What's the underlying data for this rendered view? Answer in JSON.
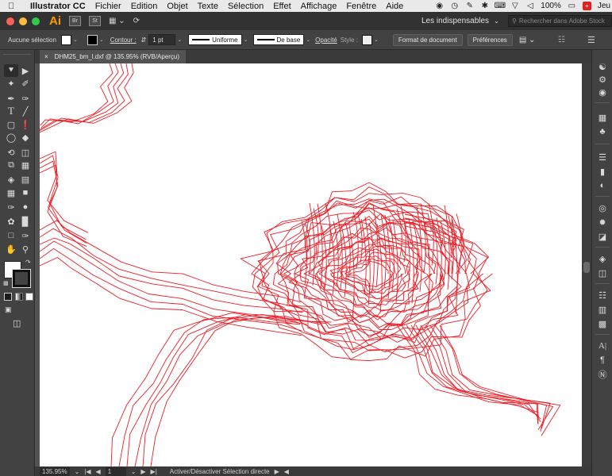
{
  "menubar": {
    "app_name": "Illustrator CC",
    "items": [
      "Fichier",
      "Edition",
      "Objet",
      "Texte",
      "Sélection",
      "Effet",
      "Affichage",
      "Fenêtre",
      "Aide"
    ],
    "battery": "100%",
    "clock": "Jeu"
  },
  "appbar": {
    "logo": "Ai",
    "bridge_label": "Br",
    "stock_label": "St",
    "workspace": "Les indispensables",
    "search_placeholder": "Rechercher dans Adobe Stock"
  },
  "controlbar": {
    "selection_label": "Aucune sélection",
    "stroke_label": "Contour :",
    "stroke_weight": "1 pt",
    "profile": "Uniforme",
    "brush": "De base",
    "opacity_label": "Opacité",
    "style_label": "Style :",
    "doc_setup": "Format de document",
    "preferences": "Préférences"
  },
  "document": {
    "tab_title": "DHM25_bm_l.dxf @ 135.95% (RVB/Aperçu)",
    "close_symbol": "×"
  },
  "statusbar": {
    "zoom": "135.95%",
    "artboard_num": "1",
    "status_text": "Activer/Désactiver Sélection directe"
  },
  "colors": {
    "contour_stroke": "#ee1c25",
    "ui_dark": "#424242",
    "accent_orange": "#ff9a00"
  },
  "icons": {
    "tools": [
      "selection-tool-icon",
      "direct-selection-tool-icon",
      "magic-wand-icon",
      "lasso-icon",
      "pen-icon",
      "curvature-icon",
      "type-icon",
      "line-icon",
      "rectangle-icon",
      "paintbrush-icon",
      "shaper-icon",
      "eraser-icon",
      "rotate-icon",
      "scale-icon",
      "width-icon",
      "free-transform-icon",
      "shape-builder-icon",
      "perspective-icon",
      "mesh-icon",
      "gradient-icon",
      "eyedropper-icon",
      "blend-icon",
      "symbol-sprayer-icon",
      "graph-icon",
      "artboard-icon",
      "slice-icon",
      "hand-icon",
      "zoom-icon"
    ],
    "dock": [
      "libraries-icon",
      "properties-icon",
      "layers-icon",
      "color-icon",
      "swatches-icon",
      "brushes-icon",
      "symbols-icon",
      "stroke-icon",
      "gradient-panel-icon",
      "transparency-icon",
      "appearance-icon",
      "graphic-styles-icon",
      "align-icon",
      "pathfinder-icon",
      "transform-icon",
      "character-icon",
      "paragraph-icon",
      "opentype-icon"
    ]
  }
}
